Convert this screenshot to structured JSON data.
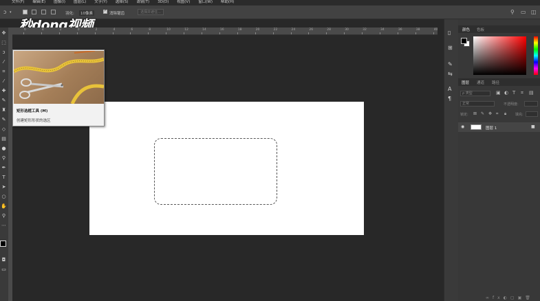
{
  "menu": [
    "文件(F)",
    "编辑(E)",
    "图像(I)",
    "图层(L)",
    "文字(Y)",
    "选择(S)",
    "滤镜(T)",
    "3D(D)",
    "视图(V)",
    "窗口(W)",
    "帮助(H)"
  ],
  "options": {
    "feather_label": "羽化:",
    "feather_value": "10像素",
    "antialias_label": "消除锯齿",
    "select_mask_label": "选择并遮住..."
  },
  "watermark": "秒dong视频",
  "ruler_ticks": [
    "6",
    "4",
    "2",
    "0",
    "2",
    "4",
    "6",
    "8",
    "10",
    "12",
    "14",
    "16",
    "18",
    "20",
    "22",
    "24",
    "26",
    "28",
    "30",
    "32",
    "34",
    "36",
    "38",
    "40",
    "42"
  ],
  "tooltip": {
    "title": "矩形选框工具 (M)",
    "description": "创建矩形形状的选区"
  },
  "color_panel": {
    "tabs": [
      "颜色",
      "色板"
    ],
    "foreground": "#000000",
    "background": "#ffffff"
  },
  "layers_panel": {
    "tabs": [
      "图层",
      "通道",
      "路径"
    ],
    "filter_kind": "ρ 类型",
    "blend_mode": "正常",
    "opacity_label": "不透明度:",
    "lock_label": "锁定:",
    "fill_label": "填充:",
    "layer_name": "图层 1"
  },
  "colors": {
    "canvas": "#ffffff",
    "workspace": "#282828",
    "panel": "#383838"
  }
}
